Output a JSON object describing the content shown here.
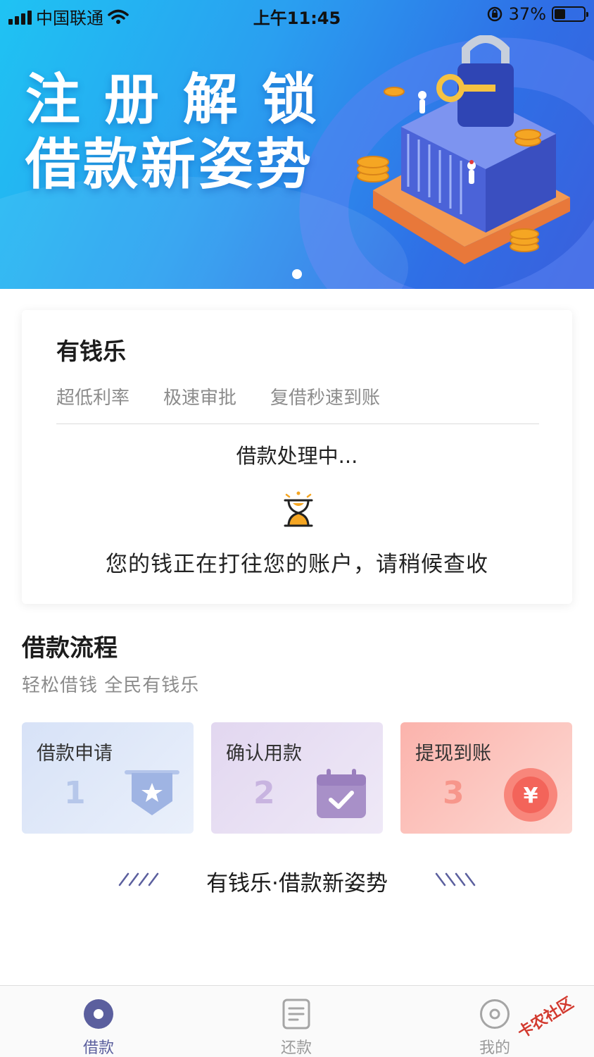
{
  "status_bar": {
    "carrier": "中国联通",
    "time": "上午11:45",
    "battery_percent": "37%",
    "battery_level": 0.37
  },
  "banner": {
    "title_line1": "注册解锁",
    "title_line2": "借款新姿势",
    "page_count": 1,
    "active_page": 1
  },
  "status_card": {
    "title": "有钱乐",
    "tags": [
      "超低利率",
      "极速审批",
      "复借秒速到账"
    ],
    "processing_text": "借款处理中...",
    "message": "您的钱正在打往您的账户，请稍候查收"
  },
  "process": {
    "title": "借款流程",
    "subtitle": "轻松借钱  全民有钱乐",
    "steps": [
      {
        "label": "借款申请",
        "number": "1",
        "icon": "badge-star-icon"
      },
      {
        "label": "确认用款",
        "number": "2",
        "icon": "calendar-check-icon"
      },
      {
        "label": "提现到账",
        "number": "3",
        "icon": "yuan-coin-icon",
        "symbol": "¥"
      }
    ]
  },
  "slogan": "有钱乐·借款新姿势",
  "tabbar": {
    "tabs": [
      {
        "label": "借款",
        "icon": "loan-icon",
        "active": true
      },
      {
        "label": "还款",
        "icon": "document-icon",
        "active": false
      },
      {
        "label": "我的",
        "icon": "profile-circle-icon",
        "active": false
      }
    ]
  },
  "watermark": "卡农社区",
  "colors": {
    "banner_start": "#1fc3f3",
    "banner_end": "#3a5fdc",
    "accent_active": "#5b5f9e",
    "coin_orange": "#f5a623",
    "step3_red": "#f3645a"
  }
}
